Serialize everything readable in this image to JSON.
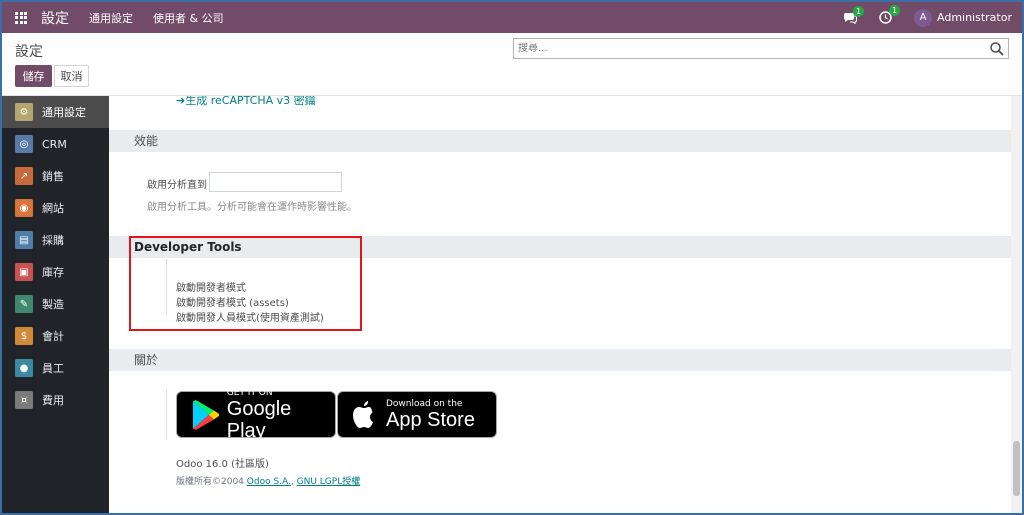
{
  "navbar": {
    "brand": "設定",
    "menu": [
      "通用設定",
      "使用者 & 公司"
    ],
    "messages_count": "1",
    "activities_count": "1",
    "avatar_letter": "A",
    "user_name": "Administrator"
  },
  "control_panel": {
    "breadcrumb": "設定",
    "search_placeholder": "搜尋...",
    "save_label": "儲存",
    "discard_label": "取消"
  },
  "sidebar": {
    "items": [
      {
        "label": "通用設定",
        "icon": "settings-icon",
        "color": "#b5a66f",
        "active": true
      },
      {
        "label": "CRM",
        "icon": "crm-icon",
        "color": "#5a7aa8"
      },
      {
        "label": "銷售",
        "icon": "sales-icon",
        "color": "#c76a3c"
      },
      {
        "label": "網站",
        "icon": "website-icon",
        "color": "#d8753b"
      },
      {
        "label": "採購",
        "icon": "purchase-icon",
        "color": "#4f7fa8"
      },
      {
        "label": "庫存",
        "icon": "inventory-icon",
        "color": "#c85353"
      },
      {
        "label": "製造",
        "icon": "manufacturing-icon",
        "color": "#3f8a6e"
      },
      {
        "label": "會計",
        "icon": "accounting-icon",
        "color": "#d08a3a"
      },
      {
        "label": "員工",
        "icon": "employees-icon",
        "color": "#3b8aa0"
      },
      {
        "label": "費用",
        "icon": "expenses-icon",
        "color": "#7a7a7a"
      }
    ]
  },
  "content": {
    "recaptcha_link": "生成 reCAPTCHA v3 密鑰",
    "performance": {
      "title": "效能",
      "field_label": "啟用分析直到",
      "field_value": "",
      "help": "啟用分析工具。分析可能會在運作時影響性能。"
    },
    "developer_tools": {
      "title": "Developer Tools",
      "links": [
        "啟動開發者模式",
        "啟動開發者模式 (assets)",
        "啟動開發人員模式(使用資產測試)"
      ]
    },
    "about": {
      "title": "關於",
      "google_play": {
        "small": "GET IT ON",
        "big": "Google Play"
      },
      "app_store": {
        "small": "Download on the",
        "big": "App Store"
      },
      "version": "Odoo 16.0 (社區版)",
      "copyright_prefix": "版權所有©2004",
      "company_link": "Odoo S.A.",
      "license_link": "GNU LGPL授權"
    }
  },
  "colors": {
    "brand": "#714b67",
    "highlight": "#e0161c",
    "link": "#017e84"
  }
}
